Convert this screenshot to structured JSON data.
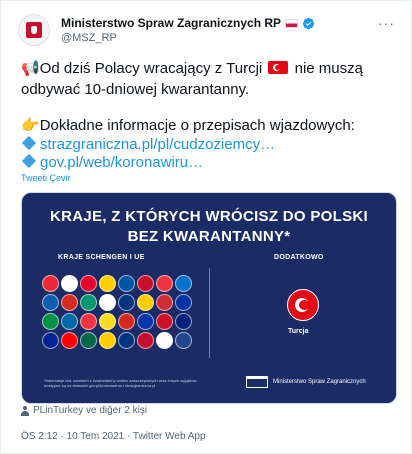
{
  "author": {
    "display_name": "Ministerstwo Spraw Zagranicznych RP",
    "handle": "@MSZ_RP",
    "more_label": "···",
    "verified_icon": "verified-badge-icon"
  },
  "tweet": {
    "line1_before_flag": "Od dziś Polacy wracający z Turcji",
    "line1_after_flag": "nie muszą",
    "line2": "odbywać 10-dniowej kwarantanny.",
    "line3": "Dokładne informacje o przepisach wjazdowych:",
    "link1": "strazgraniczna.pl/pl/cudzoziemcy…",
    "link2": "gov.pl/web/koronawiru…",
    "translate_label": "Tweeti Çevir"
  },
  "media": {
    "title_line1": "KRAJE, Z KTÓRYCH WRÓCISZ DO POLSKI",
    "title_line2": "BEZ  KWARANTANNY*",
    "left_heading": "KRAJE SCHENGEN I UE",
    "right_heading": "DODATKOWO",
    "turkey_label": "Turcja",
    "footnote": "*Informacje dot. zwolnień z kwarantanny wobec zaszczepionych oraz innych wyjątków dostępne są na stronach gov.pl/koronawirus i strazgraniczna.pl",
    "logo_text": "Ministerstwo Spraw Zagranicznych",
    "flag_colors": [
      "#ed2939",
      "#ffffff",
      "#e4002b",
      "#ffce00",
      "#0055a4",
      "#c8102e",
      "#ef3340",
      "#0072ce",
      "#0d5eaf",
      "#d52b1e",
      "#00966e",
      "#ffffff",
      "#003580",
      "#ffcc00",
      "#ce2b37",
      "#0033a0",
      "#009246",
      "#006aa7",
      "#ef3340",
      "#fdda24",
      "#d52b1e",
      "#0035ad",
      "#ce1126",
      "#00247d",
      "#002395",
      "#ff0000",
      "#006847",
      "#ffce00",
      "#003580",
      "#c60c30",
      "#ffffff",
      "#21468b"
    ]
  },
  "footer": {
    "likers": "PLinTurkey ve diğer 2 kişi",
    "meta": "ÖS 2:12 · 10 Tem 2021 · Twitter Web App"
  }
}
